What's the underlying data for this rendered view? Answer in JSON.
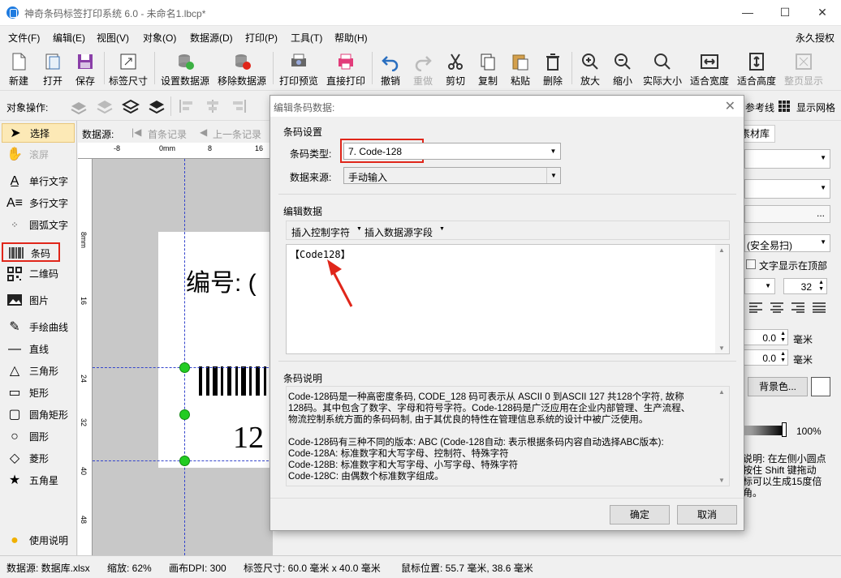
{
  "window": {
    "title": "神奇条码标签打印系统 6.0 - 未命名1.lbcp*",
    "minimize": "—",
    "maximize": "☐",
    "close": "✕"
  },
  "menu": {
    "items": [
      "文件(F)",
      "编辑(E)",
      "视图(V)",
      "对象(O)",
      "数据源(D)",
      "打印(P)",
      "工具(T)",
      "帮助(H)"
    ],
    "license": "永久授权"
  },
  "toolbar": {
    "buttons": [
      "新建",
      "打开",
      "保存",
      "标签尺寸",
      "设置数据源",
      "移除数据源",
      "打印预览",
      "直接打印",
      "撤销",
      "重做",
      "剪切",
      "复制",
      "粘贴",
      "删除",
      "放大",
      "缩小",
      "实际大小",
      "适合宽度",
      "适合高度",
      "整页显示"
    ]
  },
  "objbar": {
    "label": "对象操作:",
    "ref_line": "参考线",
    "grid": "显示网格"
  },
  "tools": [
    "选择",
    "滚屏",
    "单行文字",
    "多行文字",
    "圆弧文字",
    "条码",
    "二维码",
    "图片",
    "手绘曲线",
    "直线",
    "三角形",
    "矩形",
    "圆角矩形",
    "圆形",
    "菱形",
    "五角星",
    "使用说明"
  ],
  "datasource_nav": {
    "label": "数据源:",
    "first": "首条记录",
    "prev": "上一条记录"
  },
  "ruler": {
    "h": [
      "-8",
      "0mm",
      "8",
      "16"
    ],
    "v": [
      "8mm",
      "16",
      "24",
      "32",
      "40",
      "48"
    ]
  },
  "label_canvas": {
    "text_prefix": "编号: (",
    "barcode_digits": "12"
  },
  "right_panel": {
    "tab": "素材库",
    "symbology": "(安全易扫)",
    "text_top": "文字显示在顶部",
    "font_size": "32",
    "spin1": "0.0",
    "spin2": "0.0",
    "unit": "毫米",
    "bgcolor": "背景色...",
    "opacity": "100%",
    "help": "说明: 在左侧小圆点\n按住 Shift 键拖动\n标可以生成15度倍\n角。"
  },
  "status": {
    "datasource": "数据源: 数据库.xlsx",
    "zoom": "缩放: 62%",
    "dpi": "画布DPI: 300",
    "size": "标签尺寸: 60.0 毫米 x 40.0 毫米",
    "mouse": "鼠标位置: 55.7 毫米, 38.6 毫米"
  },
  "dialog": {
    "title": "编辑条码数据:",
    "settings_group": "条码设置",
    "type_label": "条码类型:",
    "type_value": "7. Code-128",
    "source_label": "数据来源:",
    "source_value": "手动输入",
    "edit_group": "编辑数据",
    "insert_ctrl": "插入控制字符",
    "insert_field": "插入数据源字段",
    "data_value": "【Code128】",
    "desc_group": "条码说明",
    "desc_lines": [
      "Code-128码是一种高密度条码, CODE_128 码可表示从 ASCII 0 到ASCII 127 共128个字符, 故称",
      "128码。其中包含了数字、字母和符号字符。Code-128码是广泛应用在企业内部管理、生产流程、",
      "物流控制系统方面的条码码制, 由于其优良的特性在管理信息系统的设计中被广泛使用。",
      "",
      "Code-128码有三种不同的版本: ABC (Code-128自动: 表示根据条码内容自动选择ABC版本):",
      "Code-128A: 标准数字和大写字母、控制符、特殊字符",
      "Code-128B: 标准数字和大写字母、小写字母、特殊字符",
      "Code-128C: 由偶数个标准数字组成。"
    ],
    "ok": "确定",
    "cancel": "取消"
  },
  "colors": {
    "highlight": "#e0261a",
    "selection": "#fce9b6",
    "handle": "#22cc22"
  }
}
